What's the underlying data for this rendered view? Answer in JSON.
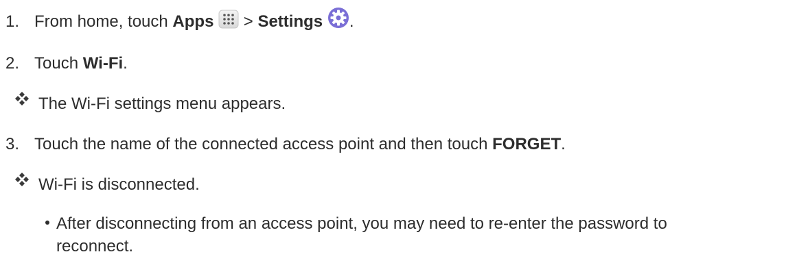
{
  "steps": [
    {
      "number": "1.",
      "prefix": "From home, touch ",
      "apps": "Apps",
      "separator": " > ",
      "settings": "Settings",
      "suffix": "."
    },
    {
      "number": "2.",
      "prefix": "Touch ",
      "bold": "Wi-Fi",
      "suffix": "."
    },
    {
      "number": "3.",
      "prefix": "Touch the name of the connected access point and then touch ",
      "bold": "FORGET",
      "suffix": "."
    }
  ],
  "results": {
    "after_step2": "The Wi-Fi settings menu appears.",
    "after_step3": "Wi-Fi is disconnected."
  },
  "note": {
    "line1": "After disconnecting from an access point, you may need to re-enter the password to",
    "line2": "reconnect."
  },
  "icons": {
    "apps": "apps-grid-icon",
    "settings": "settings-gear-icon",
    "result": "result-diamond-icon"
  },
  "colors": {
    "text": "#2d2d2d",
    "settings_icon": "#7b6fd6",
    "diamond_dark": "#3a3a3a"
  }
}
